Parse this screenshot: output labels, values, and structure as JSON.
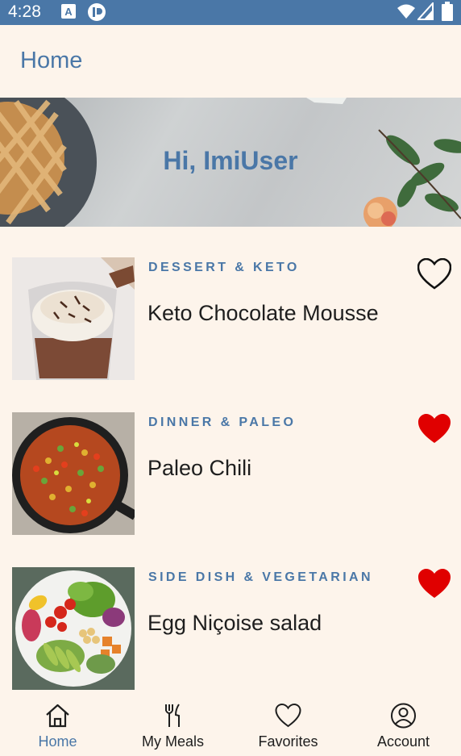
{
  "status_bar": {
    "time": "4:28",
    "icons": [
      "keyboard-a-icon",
      "app-icon",
      "wifi-icon",
      "signal-icon",
      "battery-icon"
    ]
  },
  "app_bar": {
    "title": "Home"
  },
  "hero": {
    "greeting": "Hi, ImiUser"
  },
  "meals": [
    {
      "category": "DESSERT & KETO",
      "name": "Keto Chocolate Mousse",
      "favorited": false
    },
    {
      "category": "DINNER & PALEO",
      "name": "Paleo Chili",
      "favorited": true
    },
    {
      "category": "SIDE DISH & VEGETARIAN",
      "name": "Egg Niçoise salad",
      "favorited": true
    }
  ],
  "bottom_nav": [
    {
      "label": "Home",
      "icon": "home-icon",
      "active": true
    },
    {
      "label": "My Meals",
      "icon": "fork-knife-icon",
      "active": false
    },
    {
      "label": "Favorites",
      "icon": "heart-icon",
      "active": false
    },
    {
      "label": "Account",
      "icon": "account-icon",
      "active": false
    }
  ],
  "colors": {
    "accent": "#4a77a7",
    "background": "#fdf4eb",
    "favorite": "#e00000"
  }
}
